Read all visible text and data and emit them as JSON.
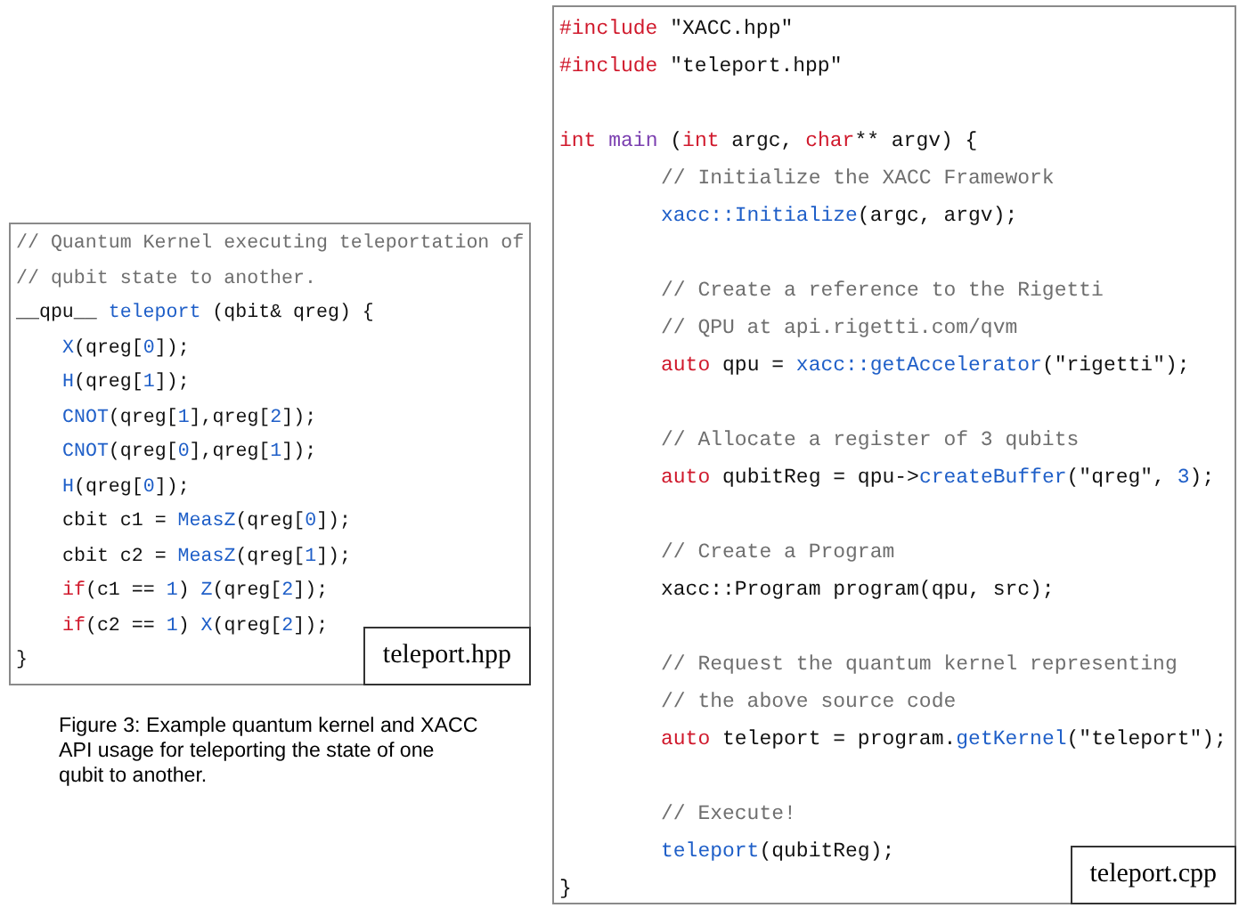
{
  "kernel_listing": {
    "filename": "teleport.hpp",
    "lines": [
      {
        "kind": "code",
        "indented": false,
        "tokens": [
          {
            "kind": "comment",
            "text": "// Quantum Kernel executing teleportation of"
          }
        ]
      },
      {
        "kind": "code",
        "indented": false,
        "tokens": [
          {
            "kind": "comment",
            "text": "// qubit state to another."
          }
        ]
      },
      {
        "kind": "code",
        "indented": false,
        "tokens": [
          {
            "kind": "plain",
            "text": "__qpu__ "
          },
          {
            "kind": "func",
            "text": "teleport"
          },
          {
            "kind": "plain",
            "text": " (qbit& qreg) {"
          }
        ]
      },
      {
        "kind": "code",
        "indented": true,
        "tokens": [
          {
            "kind": "func",
            "text": "X"
          },
          {
            "kind": "plain",
            "text": "(qreg["
          },
          {
            "kind": "func",
            "text": "0"
          },
          {
            "kind": "plain",
            "text": "]);"
          }
        ]
      },
      {
        "kind": "code",
        "indented": true,
        "tokens": [
          {
            "kind": "func",
            "text": "H"
          },
          {
            "kind": "plain",
            "text": "(qreg["
          },
          {
            "kind": "func",
            "text": "1"
          },
          {
            "kind": "plain",
            "text": "]);"
          }
        ]
      },
      {
        "kind": "code",
        "indented": true,
        "tokens": [
          {
            "kind": "func",
            "text": "CNOT"
          },
          {
            "kind": "plain",
            "text": "(qreg["
          },
          {
            "kind": "func",
            "text": "1"
          },
          {
            "kind": "plain",
            "text": "],qreg["
          },
          {
            "kind": "func",
            "text": "2"
          },
          {
            "kind": "plain",
            "text": "]);"
          }
        ]
      },
      {
        "kind": "code",
        "indented": true,
        "tokens": [
          {
            "kind": "func",
            "text": "CNOT"
          },
          {
            "kind": "plain",
            "text": "(qreg["
          },
          {
            "kind": "func",
            "text": "0"
          },
          {
            "kind": "plain",
            "text": "],qreg["
          },
          {
            "kind": "func",
            "text": "1"
          },
          {
            "kind": "plain",
            "text": "]);"
          }
        ]
      },
      {
        "kind": "code",
        "indented": true,
        "tokens": [
          {
            "kind": "func",
            "text": "H"
          },
          {
            "kind": "plain",
            "text": "(qreg["
          },
          {
            "kind": "func",
            "text": "0"
          },
          {
            "kind": "plain",
            "text": "]);"
          }
        ]
      },
      {
        "kind": "code",
        "indented": true,
        "tokens": [
          {
            "kind": "plain",
            "text": "cbit c1 = "
          },
          {
            "kind": "func",
            "text": "MeasZ"
          },
          {
            "kind": "plain",
            "text": "(qreg["
          },
          {
            "kind": "func",
            "text": "0"
          },
          {
            "kind": "plain",
            "text": "]);"
          }
        ]
      },
      {
        "kind": "code",
        "indented": true,
        "tokens": [
          {
            "kind": "plain",
            "text": "cbit c2 = "
          },
          {
            "kind": "func",
            "text": "MeasZ"
          },
          {
            "kind": "plain",
            "text": "(qreg["
          },
          {
            "kind": "func",
            "text": "1"
          },
          {
            "kind": "plain",
            "text": "]);"
          }
        ]
      },
      {
        "kind": "code",
        "indented": true,
        "tokens": [
          {
            "kind": "keyword",
            "text": "if"
          },
          {
            "kind": "plain",
            "text": "(c1 == "
          },
          {
            "kind": "func",
            "text": "1"
          },
          {
            "kind": "plain",
            "text": ") "
          },
          {
            "kind": "func",
            "text": "Z"
          },
          {
            "kind": "plain",
            "text": "(qreg["
          },
          {
            "kind": "func",
            "text": "2"
          },
          {
            "kind": "plain",
            "text": "]);"
          }
        ]
      },
      {
        "kind": "code",
        "indented": true,
        "tokens": [
          {
            "kind": "keyword",
            "text": "if"
          },
          {
            "kind": "plain",
            "text": "(c2 == "
          },
          {
            "kind": "func",
            "text": "1"
          },
          {
            "kind": "plain",
            "text": ") "
          },
          {
            "kind": "func",
            "text": "X"
          },
          {
            "kind": "plain",
            "text": "(qreg["
          },
          {
            "kind": "func",
            "text": "2"
          },
          {
            "kind": "plain",
            "text": "]);"
          }
        ]
      },
      {
        "kind": "code",
        "indented": false,
        "tokens": [
          {
            "kind": "plain",
            "text": "}"
          }
        ]
      }
    ]
  },
  "caption": "Figure 3: Example quantum kernel and XACC API usage for teleporting the state of one qubit to another.",
  "host_listing": {
    "filename": "teleport.cpp",
    "lines": [
      {
        "kind": "code",
        "indented": false,
        "tokens": [
          {
            "kind": "keyword",
            "text": "#include"
          },
          {
            "kind": "plain",
            "text": " \"XACC.hpp\""
          }
        ]
      },
      {
        "kind": "code",
        "indented": false,
        "tokens": [
          {
            "kind": "keyword",
            "text": "#include"
          },
          {
            "kind": "plain",
            "text": " \"teleport.hpp\""
          }
        ]
      },
      {
        "kind": "blank"
      },
      {
        "kind": "code",
        "indented": false,
        "tokens": [
          {
            "kind": "keyword",
            "text": "int"
          },
          {
            "kind": "type",
            "text": " main"
          },
          {
            "kind": "plain",
            "text": " ("
          },
          {
            "kind": "keyword",
            "text": "int"
          },
          {
            "kind": "plain",
            "text": " argc, "
          },
          {
            "kind": "keyword",
            "text": "char"
          },
          {
            "kind": "plain",
            "text": "** argv) {"
          }
        ]
      },
      {
        "kind": "code",
        "indented": true,
        "tokens": [
          {
            "kind": "comment",
            "text": "// Initialize the XACC Framework"
          }
        ]
      },
      {
        "kind": "code",
        "indented": true,
        "tokens": [
          {
            "kind": "func",
            "text": "xacc::Initialize"
          },
          {
            "kind": "plain",
            "text": "(argc, argv);"
          }
        ]
      },
      {
        "kind": "blank"
      },
      {
        "kind": "code",
        "indented": true,
        "tokens": [
          {
            "kind": "comment",
            "text": "// Create a reference to the Rigetti"
          }
        ]
      },
      {
        "kind": "code",
        "indented": true,
        "tokens": [
          {
            "kind": "comment",
            "text": "// QPU at api.rigetti.com/qvm"
          }
        ]
      },
      {
        "kind": "code",
        "indented": true,
        "tokens": [
          {
            "kind": "keyword",
            "text": "auto"
          },
          {
            "kind": "plain",
            "text": " qpu = "
          },
          {
            "kind": "func",
            "text": "xacc::getAccelerator"
          },
          {
            "kind": "plain",
            "text": "(\"rigetti\");"
          }
        ]
      },
      {
        "kind": "blank"
      },
      {
        "kind": "code",
        "indented": true,
        "tokens": [
          {
            "kind": "comment",
            "text": "// Allocate a register of 3 qubits"
          }
        ]
      },
      {
        "kind": "code",
        "indented": true,
        "tokens": [
          {
            "kind": "keyword",
            "text": "auto"
          },
          {
            "kind": "plain",
            "text": " qubitReg = qpu->"
          },
          {
            "kind": "func",
            "text": "createBuffer"
          },
          {
            "kind": "plain",
            "text": "(\"qreg\", "
          },
          {
            "kind": "func",
            "text": "3"
          },
          {
            "kind": "plain",
            "text": ");"
          }
        ]
      },
      {
        "kind": "blank"
      },
      {
        "kind": "code",
        "indented": true,
        "tokens": [
          {
            "kind": "comment",
            "text": "// Create a Program"
          }
        ]
      },
      {
        "kind": "code",
        "indented": true,
        "tokens": [
          {
            "kind": "plain",
            "text": "xacc::Program program(qpu, src);"
          }
        ]
      },
      {
        "kind": "blank"
      },
      {
        "kind": "code",
        "indented": true,
        "tokens": [
          {
            "kind": "comment",
            "text": "// Request the quantum kernel representing"
          }
        ]
      },
      {
        "kind": "code",
        "indented": true,
        "tokens": [
          {
            "kind": "comment",
            "text": "// the above source code"
          }
        ]
      },
      {
        "kind": "code",
        "indented": true,
        "tokens": [
          {
            "kind": "keyword",
            "text": "auto"
          },
          {
            "kind": "plain",
            "text": " teleport = program."
          },
          {
            "kind": "func",
            "text": "getKernel"
          },
          {
            "kind": "plain",
            "text": "(\"teleport\");"
          }
        ]
      },
      {
        "kind": "blank"
      },
      {
        "kind": "code",
        "indented": true,
        "tokens": [
          {
            "kind": "comment",
            "text": "// Execute!"
          }
        ]
      },
      {
        "kind": "code",
        "indented": true,
        "tokens": [
          {
            "kind": "func",
            "text": "teleport"
          },
          {
            "kind": "plain",
            "text": "(qubitReg);"
          }
        ]
      },
      {
        "kind": "code",
        "indented": false,
        "tokens": [
          {
            "kind": "plain",
            "text": "}"
          }
        ]
      }
    ]
  }
}
